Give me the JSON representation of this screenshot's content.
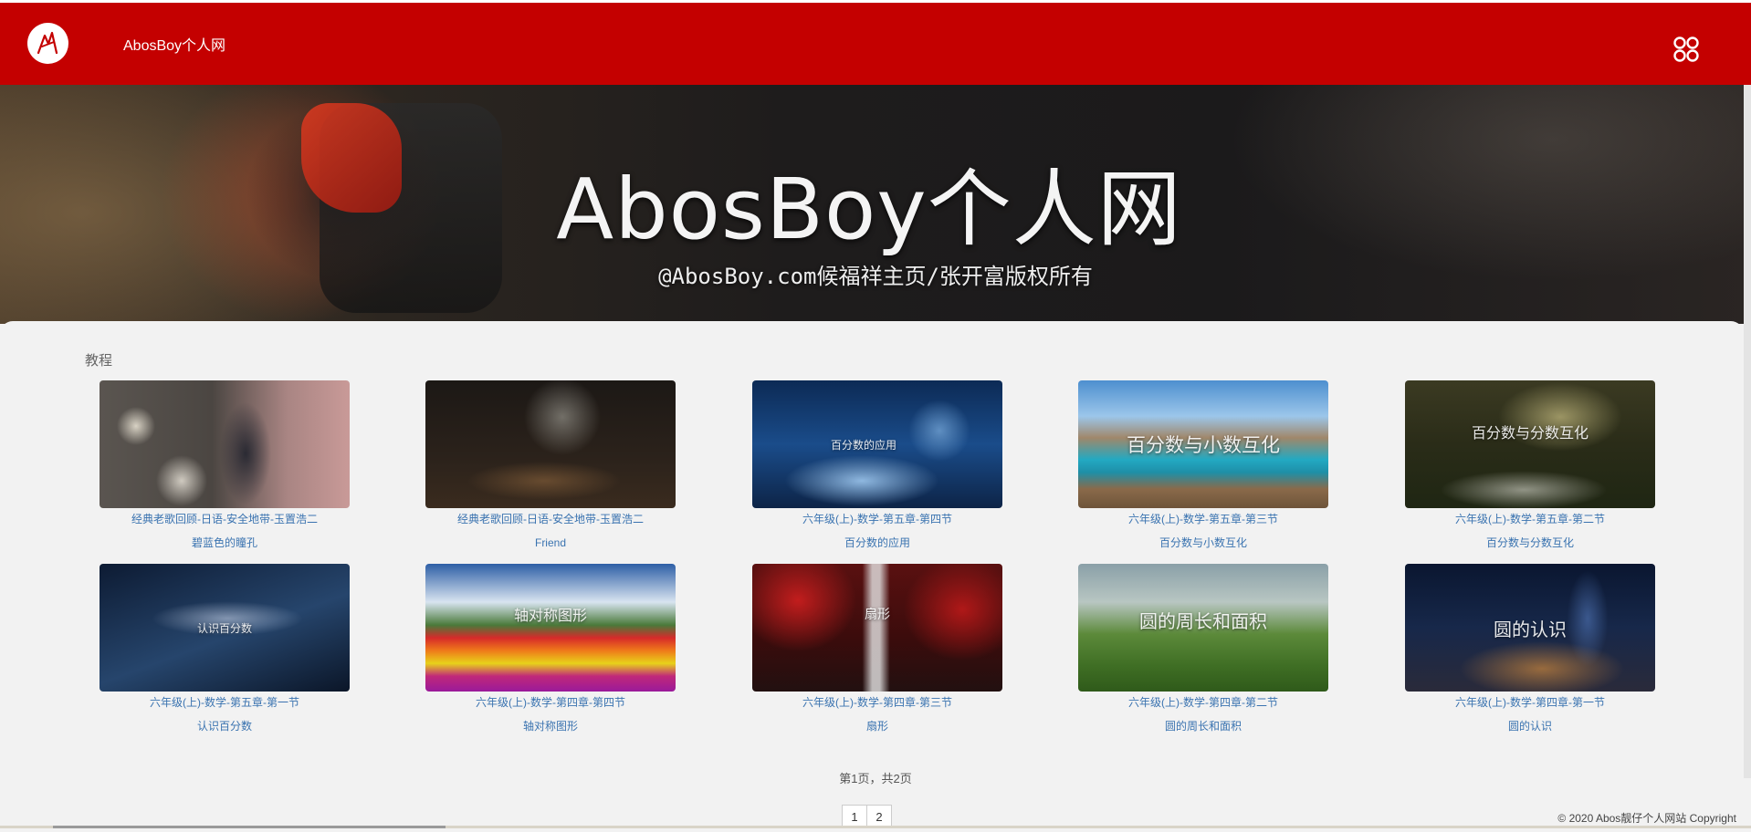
{
  "header": {
    "site_name": "AbosBoy个人网",
    "logo_icon": "abosboy-logo-icon",
    "menu_icon": "grid-menu-icon",
    "bg_color": "#c40000"
  },
  "banner": {
    "title": "AbosBoy个人网",
    "subtitle": "@AbosBoy.com候福祥主页/张开富版权所有"
  },
  "section": {
    "title": "教程"
  },
  "items": [
    {
      "line1": "经典老歌回顾-日语-安全地带-玉置浩二",
      "line2": "碧蓝色的瞳孔",
      "caption": ""
    },
    {
      "line1": "经典老歌回顾-日语-安全地带-玉置浩二",
      "line2": "Friend",
      "caption": ""
    },
    {
      "line1": "六年级(上)-数学-第五章-第四节",
      "line2": "百分数的应用",
      "caption": "百分数的应用"
    },
    {
      "line1": "六年级(上)-数学-第五章-第三节",
      "line2": "百分数与小数互化",
      "caption": "百分数与小数互化"
    },
    {
      "line1": "六年级(上)-数学-第五章-第二节",
      "line2": "百分数与分数互化",
      "caption": "百分数与分数互化"
    },
    {
      "line1": "六年级(上)-数学-第五章-第一节",
      "line2": "认识百分数",
      "caption": "认识百分数"
    },
    {
      "line1": "六年级(上)-数学-第四章-第四节",
      "line2": "轴对称图形",
      "caption": "轴对称图形"
    },
    {
      "line1": "六年级(上)-数学-第四章-第三节",
      "line2": "扇形",
      "caption": "扇形"
    },
    {
      "line1": "六年级(上)-数学-第四章-第二节",
      "line2": "圆的周长和面积",
      "caption": "圆的周长和面积"
    },
    {
      "line1": "六年级(上)-数学-第四章-第一节",
      "line2": "圆的认识",
      "caption": "圆的认识"
    }
  ],
  "pagination": {
    "summary": "第1页，共2页",
    "pages": [
      "1",
      "2"
    ]
  },
  "footer": {
    "copyright": "© 2020 Abos靓仔个人网站 Copyright"
  }
}
